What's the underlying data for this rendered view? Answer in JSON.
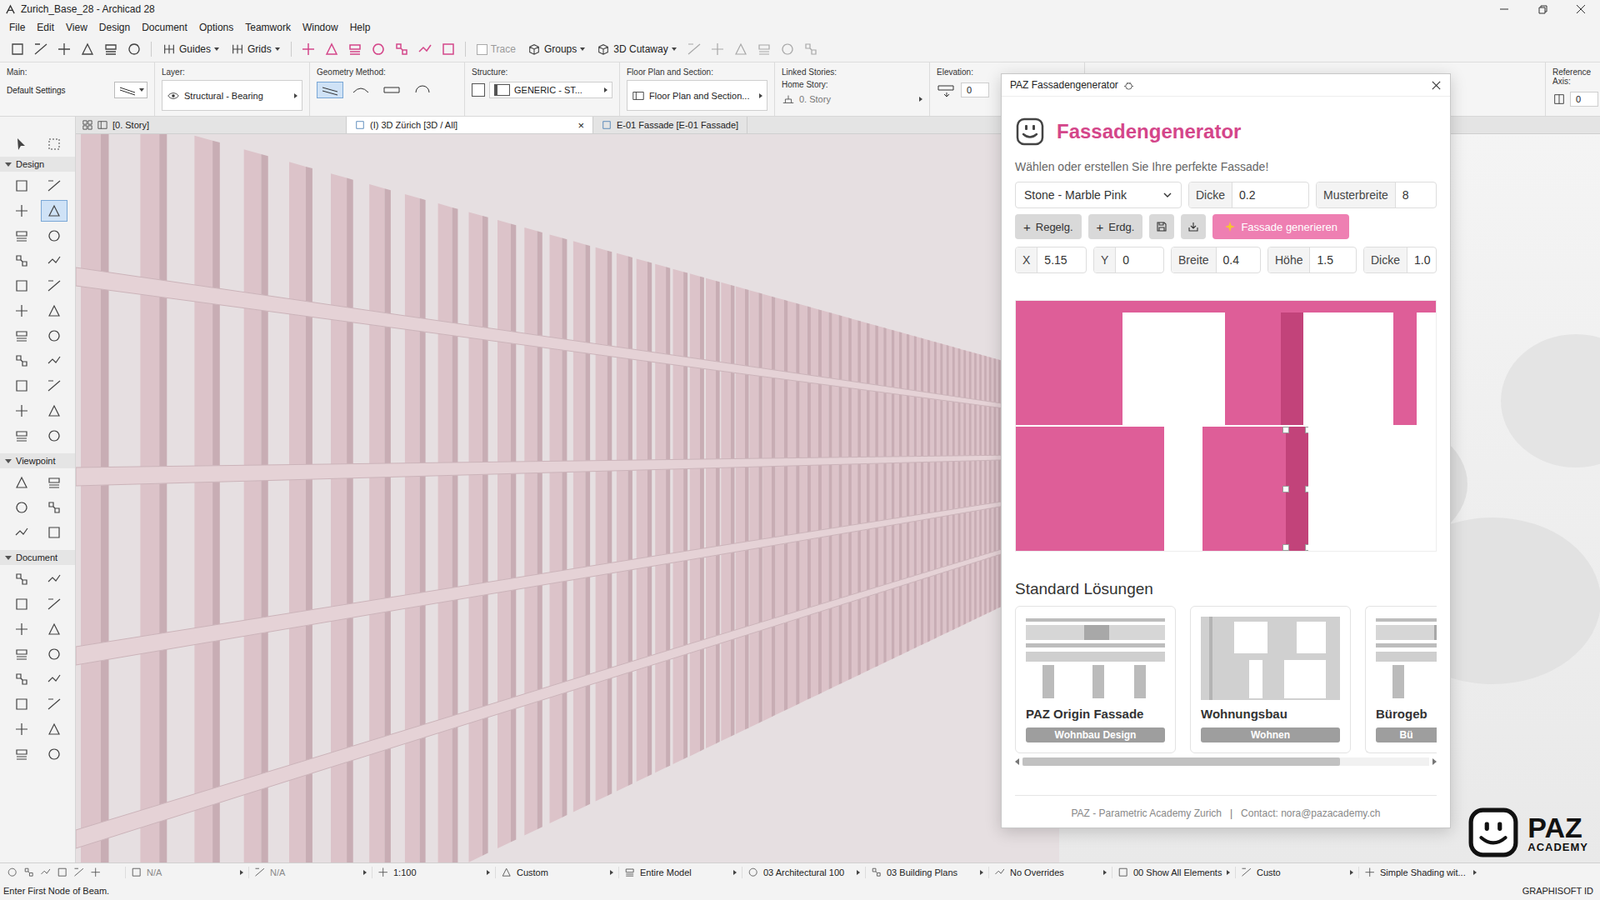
{
  "window": {
    "title": "Zurich_Base_28 - Archicad 28"
  },
  "menu": [
    "File",
    "Edit",
    "View",
    "Design",
    "Document",
    "Options",
    "Teamwork",
    "Window",
    "Help"
  ],
  "toolbar": {
    "left": [
      {
        "label": "Guides",
        "kind": "dropdown",
        "checked": false,
        "disabled": false
      },
      {
        "label": "Grids",
        "kind": "dropdown",
        "checked": false,
        "disabled": false
      }
    ],
    "right": [
      {
        "label": "Trace",
        "kind": "checkbox",
        "checked": false,
        "disabled": true
      },
      {
        "label": "Groups",
        "kind": "dropdown",
        "checked": false,
        "disabled": false
      },
      {
        "label": "3D Cutaway",
        "kind": "dropdown",
        "checked": false,
        "disabled": false
      }
    ]
  },
  "info_box": {
    "main": {
      "label": "Main:",
      "value": "Default Settings"
    },
    "layer": {
      "label": "Layer:",
      "value": "Structural - Bearing"
    },
    "geometry": {
      "label": "Geometry Method:",
      "methods": [
        {
          "selected": true
        },
        {
          "selected": false
        },
        {
          "selected": false
        },
        {
          "selected": false
        }
      ]
    },
    "structure": {
      "label": "Structure:",
      "value": "GENERIC - ST..."
    },
    "floor_plan": {
      "label": "Floor Plan and Section:",
      "value": "Floor Plan and Section..."
    },
    "linked": {
      "label": "Linked Stories:",
      "home_label": "Home Story:",
      "value": "0. Story"
    },
    "elevation": {
      "label": "Elevation:",
      "value": "0"
    },
    "reference_axis": {
      "label": "Reference Axis:",
      "value": "0"
    }
  },
  "tabs": {
    "navigator": "[0. Story]",
    "items": [
      {
        "label": "(I) 3D Zürich [3D / All]",
        "selected": true,
        "close": "×"
      },
      {
        "label": "E-01 Fassade [E-01 Fassade]",
        "selected": false,
        "close": ""
      }
    ]
  },
  "toolbox": {
    "sections": [
      {
        "label": "Design",
        "expanded": true,
        "tools": [
          {
            "selected": false
          },
          {
            "selected": false
          },
          {
            "selected": false
          },
          {
            "selected": true
          },
          {
            "selected": false
          },
          {
            "selected": false
          },
          {
            "selected": false
          },
          {
            "selected": false
          },
          {
            "selected": false
          },
          {
            "selected": false
          },
          {
            "selected": false
          },
          {
            "selected": false
          },
          {
            "selected": false
          },
          {
            "selected": false
          },
          {
            "selected": false
          },
          {
            "selected": false
          },
          {
            "selected": false
          },
          {
            "selected": false
          },
          {
            "selected": false
          },
          {
            "selected": false
          },
          {
            "selected": false
          },
          {
            "selected": false
          }
        ]
      },
      {
        "label": "Viewpoint",
        "expanded": true,
        "tools": [
          {
            "selected": false
          },
          {
            "selected": false
          },
          {
            "selected": false
          },
          {
            "selected": false
          },
          {
            "selected": false
          },
          {
            "selected": false
          }
        ]
      },
      {
        "label": "Document",
        "expanded": true,
        "tools": [
          {
            "selected": false
          },
          {
            "selected": false
          },
          {
            "selected": false
          },
          {
            "selected": false
          },
          {
            "selected": false
          },
          {
            "selected": false
          },
          {
            "selected": false
          },
          {
            "selected": false
          },
          {
            "selected": false
          },
          {
            "selected": false
          },
          {
            "selected": false
          },
          {
            "selected": false
          },
          {
            "selected": false
          },
          {
            "selected": false
          },
          {
            "selected": false
          },
          {
            "selected": false
          }
        ]
      }
    ]
  },
  "dialog": {
    "title": "PAZ Fassadengenerator",
    "heading": "Fassadengenerator",
    "subtitle": "Wählen oder erstellen Sie Ihre perfekte Fassade!",
    "material": "Stone - Marble Pink",
    "thickness": {
      "label": "Dicke",
      "value": "0.2"
    },
    "pattern_width": {
      "label": "Musterbreite",
      "value": "8"
    },
    "buttons": [
      {
        "kind": "text",
        "icon": "+",
        "label": "Regelg."
      },
      {
        "kind": "text",
        "icon": "+",
        "label": "Erdg."
      },
      {
        "kind": "save",
        "icon": "",
        "label": ""
      },
      {
        "kind": "import",
        "icon": "",
        "label": ""
      },
      {
        "kind": "primary",
        "icon": "",
        "label": "Fassade generieren"
      }
    ],
    "fields": [
      {
        "label": "X",
        "value": "5.15"
      },
      {
        "label": "Y",
        "value": "0"
      },
      {
        "label": "Breite",
        "value": "0.4"
      },
      {
        "label": "Höhe",
        "value": "1.5"
      },
      {
        "label": "Dicke",
        "value": "1.0"
      }
    ],
    "preview": {
      "selection_visible": true
    },
    "section_title": "Standard Lösungen",
    "solutions": [
      {
        "name": "PAZ Origin Fassade",
        "tag": "Wohnbau Design"
      },
      {
        "name": "Wohnungsbau",
        "tag": "Wohnen"
      },
      {
        "name": "Bürogeb",
        "tag": "Bü"
      }
    ],
    "scrollbar": {
      "level": 0.78
    },
    "footer": {
      "org": "PAZ - Parametric Academy Zurich",
      "separator": "|",
      "contact": "Contact: nora@pazacademy.ch"
    }
  },
  "status_bar": {
    "items": [
      {
        "text": "N/A",
        "disabled": true
      },
      {
        "text": "N/A",
        "disabled": true
      },
      {
        "text": "1:100",
        "disabled": false
      },
      {
        "text": "Custom",
        "disabled": false
      },
      {
        "text": "Entire Model",
        "disabled": false
      },
      {
        "text": "03 Architectural 100",
        "disabled": false
      },
      {
        "text": "03 Building Plans",
        "disabled": false
      },
      {
        "text": "No Overrides",
        "disabled": false
      },
      {
        "text": "00 Show All Elements",
        "disabled": false
      },
      {
        "text": "Custo",
        "disabled": false
      },
      {
        "text": "Simple Shading wit...",
        "disabled": false
      }
    ]
  },
  "prompt": "Enter First Node of Beam.",
  "account": "GRAPHISOFT ID",
  "watermark": {
    "name": "PAZ",
    "sub": "ACADEMY"
  }
}
